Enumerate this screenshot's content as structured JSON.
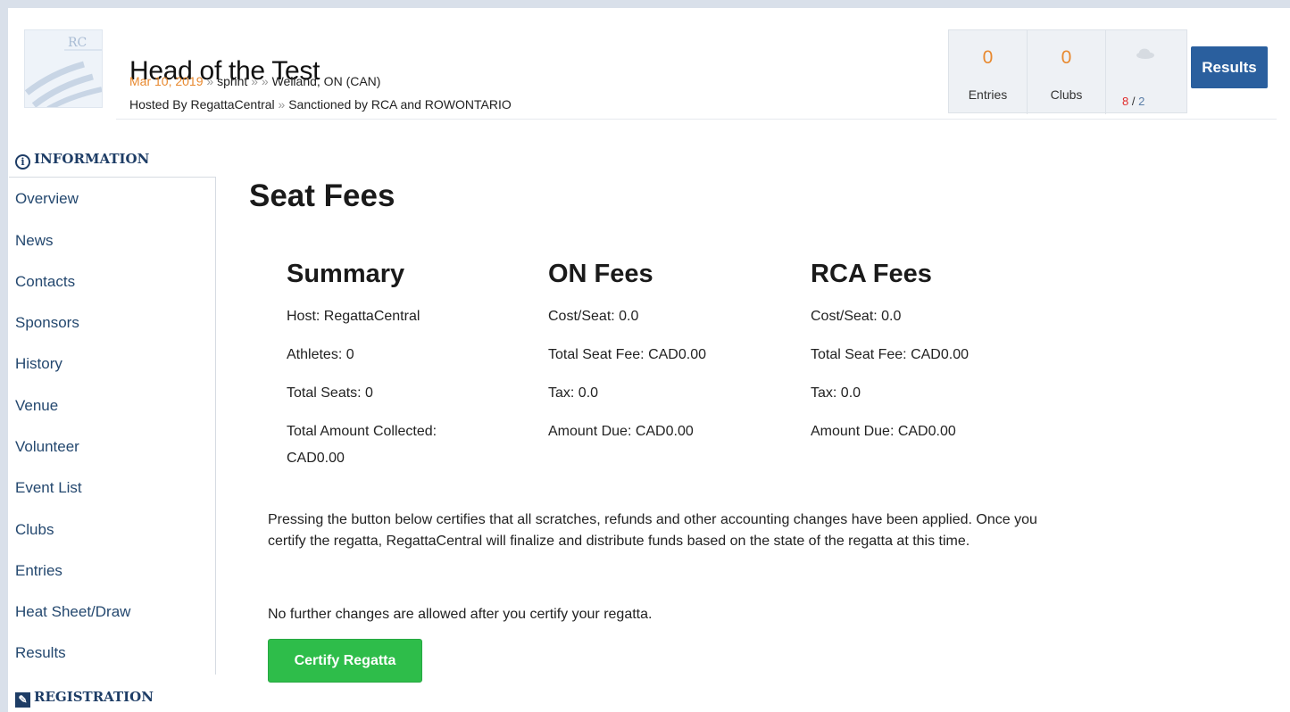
{
  "header": {
    "title": "Head of the Test",
    "date": "Mar 10, 2019",
    "crumb_sep": "»",
    "crumb_b": "sprint",
    "crumb_c": "",
    "location": "Welland, ON (CAN)",
    "host": "Hosted By RegattaCentral",
    "sanction": "Sanctioned by RCA and ROWONTARIO"
  },
  "stats": {
    "entries_count": "0",
    "entries_label": "Entries",
    "clubs_count": "0",
    "clubs_label": "Clubs",
    "weather_icon": "cloud-icon",
    "temp_high": "8",
    "temp_sep": "/",
    "temp_low": "2"
  },
  "results_button": "Results",
  "sidebar": {
    "info_heading": "INFORMATION",
    "info_icon": "i",
    "items": [
      "Overview",
      "News",
      "Contacts",
      "Sponsors",
      "History",
      "Venue",
      "Volunteer",
      "Event List",
      "Clubs",
      "Entries",
      "Heat Sheet/Draw",
      "Results"
    ],
    "registration_heading": "REGISTRATION"
  },
  "main": {
    "page_title": "Seat Fees",
    "summary": {
      "title": "Summary",
      "host": "Host: RegattaCentral",
      "athletes": "Athletes: 0",
      "total_seats": "Total Seats: 0",
      "total_collected_line1": "Total Amount Collected:",
      "total_collected_line2": "CAD0.00"
    },
    "on_fees": {
      "title": "ON Fees",
      "cost_seat": "Cost/Seat: 0.0",
      "total_seat_fee": "Total Seat Fee: CAD0.00",
      "tax": "Tax: 0.0",
      "amount_due": "Amount Due: CAD0.00"
    },
    "rca_fees": {
      "title": "RCA Fees",
      "cost_seat": "Cost/Seat: 0.0",
      "total_seat_fee": "Total Seat Fee: CAD0.00",
      "tax": "Tax: 0.0",
      "amount_due": "Amount Due: CAD0.00"
    },
    "paragraph1": "Pressing the button below certifies that all scratches, refunds and other accounting changes have been applied. Once you certify the regatta, RegattaCentral will finalize and distribute funds based on the state of the regatta at this time.",
    "paragraph2": "No further changes are allowed after you certify your regatta.",
    "certify_button": "Certify Regatta"
  },
  "colors": {
    "accent_orange": "#e8892f",
    "nav_blue": "#24486f",
    "results_blue": "#2a5f9e",
    "certify_green": "#2ebd4a"
  }
}
